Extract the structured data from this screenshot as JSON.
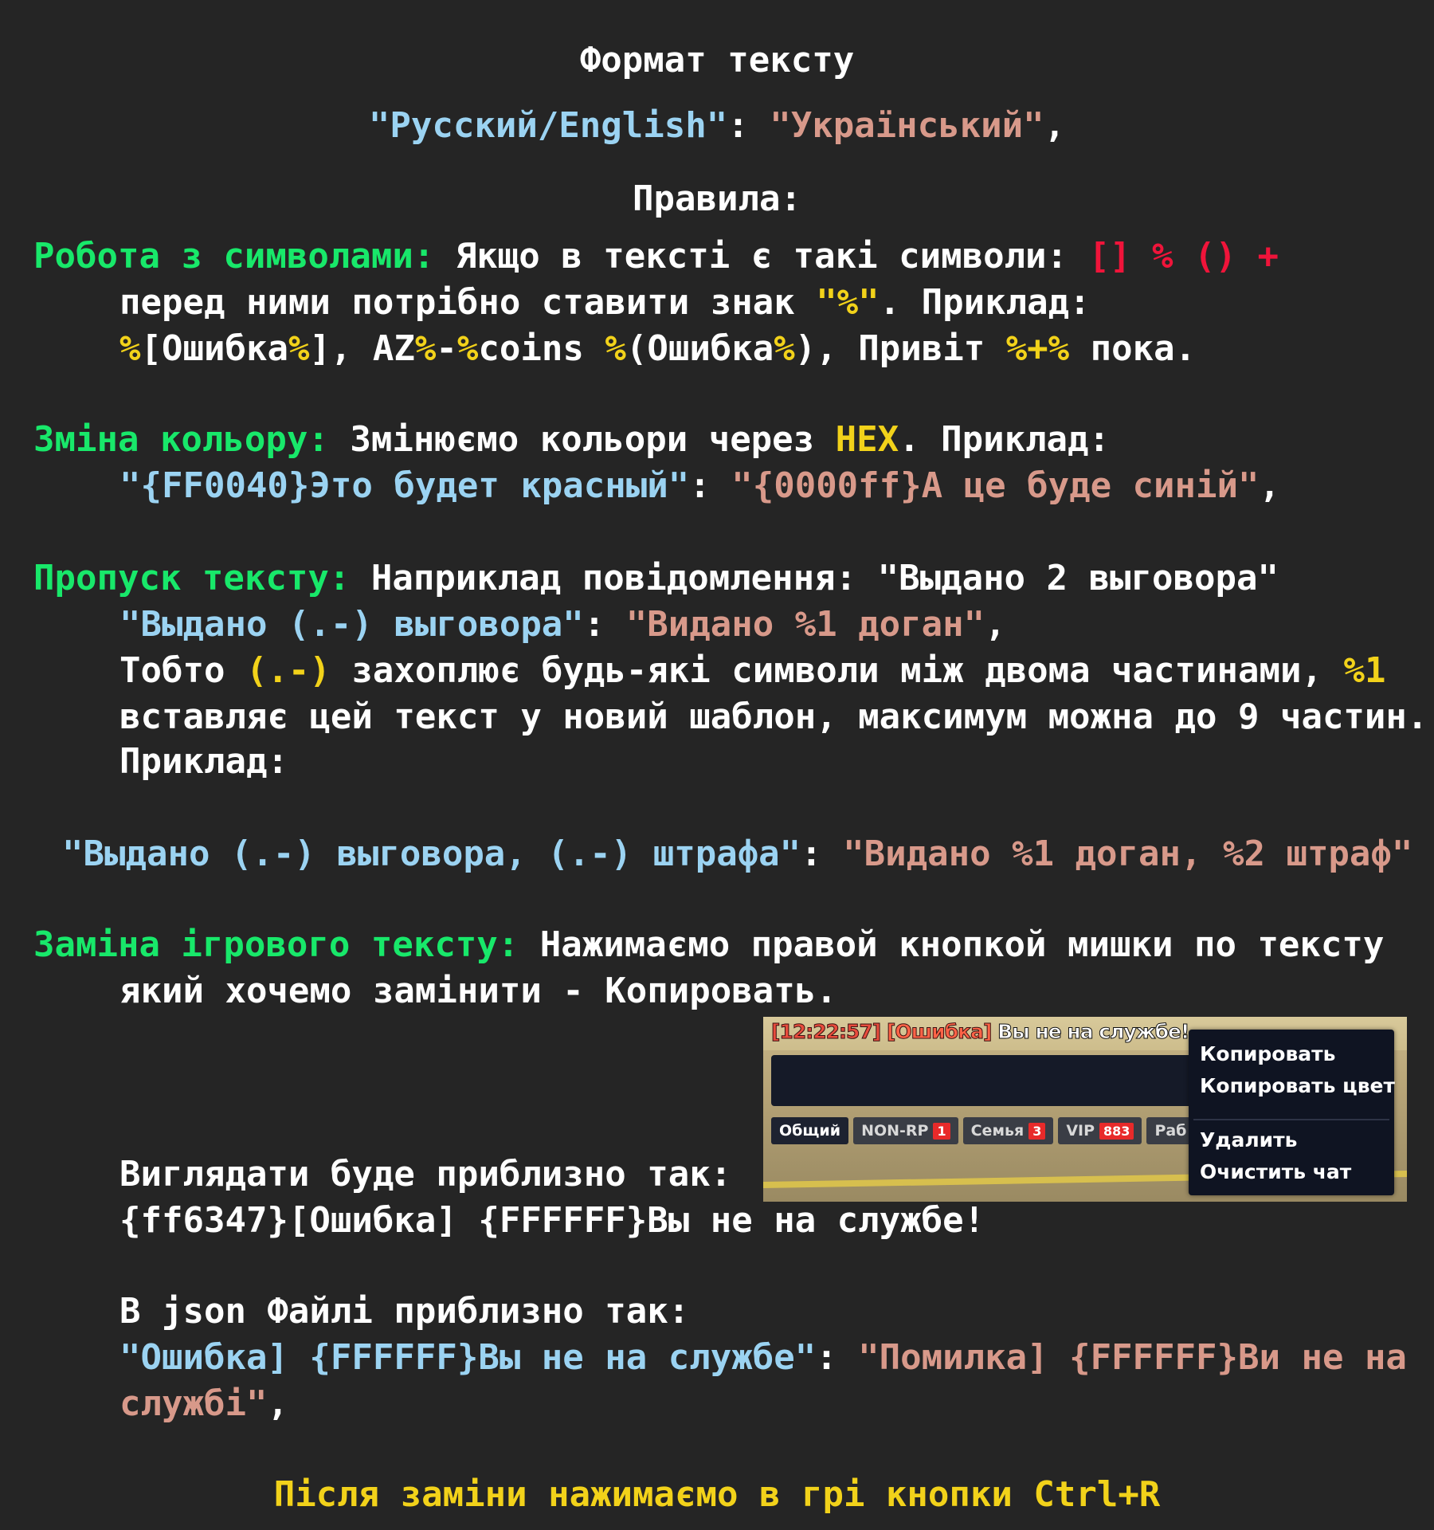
{
  "title": "Формат тексту",
  "format_line": {
    "key": "\"Русский/English\"",
    "sep": ": ",
    "value": "\"Український\"",
    "end": ","
  },
  "rules_heading": "Правила:",
  "symbols": {
    "label": "Робота з символами:",
    "text": " Якщо в тексті є такі символи: ",
    "chars": "[] % () +",
    "line2a": "перед ними потрібно ставити знак ",
    "line2b": "\"%\"",
    "line2c": ". Приклад:",
    "ex": [
      "%",
      "[Ошибка",
      "%",
      "], AZ",
      "%",
      "-",
      "%",
      "coins ",
      "%",
      "(Ошибка",
      "%",
      "), Привіт ",
      "%+%",
      " пока."
    ]
  },
  "color": {
    "label": "Зміна кольору:",
    "text1": " Змінюємо кольори через ",
    "hex": "HEX",
    "text2": ". Приклад:",
    "ex_key": "\"{FF0040}Это будет красный\"",
    "ex_sep": ": ",
    "ex_value": "\"{0000ff}А це буде синій\"",
    "ex_end": ","
  },
  "skip": {
    "label": "Пропуск тексту:",
    "text": " Наприклад повідомлення: \"Выдано 2 выговора\"",
    "ex_key": "\"Выдано (.-) выговора\"",
    "ex_sep": ": ",
    "ex_value": "\"Видано %1 доган\"",
    "ex_end": ",",
    "l3a": "Тобто ",
    "l3b": "(.-)",
    "l3c": " захоплює будь-які символи між двома частинами, ",
    "l3d": "%1",
    "l4": "вставляє цей текст у новий шаблон, максимум можна до 9 частин.",
    "l5": "Приклад:",
    "ex2_key": "\"Выдано (.-) выговора, (.-) штрафа\"",
    "ex2_sep": ": ",
    "ex2_value": "\"Видано %1 доган, %2 штраф\""
  },
  "replace": {
    "label": "Заміна ігрового тексту:",
    "text": " Нажимаємо правой кнопкой мишки по тексту",
    "l2": "який хочемо замінити - Копировать.",
    "looks": "Виглядати буде приблизно так:",
    "looks_value": "{ff6347}[Ошибка] {FFFFFF}Вы не на службе!",
    "json": "В json Файлі приблизно так:",
    "json_key": "\"Ошибка] {FFFFFF}Вы не на службе\"",
    "json_sep": ": ",
    "json_value_1": "\"Помилка] {FFFFFF}Ви не на",
    "json_value_2": "службі\"",
    "json_end": ","
  },
  "footer": "Після заміни нажимаємо в грі кнопки Ctrl+R",
  "screenshot": {
    "time": "[12:22:57]",
    "error": "[Ошибка]",
    "message": "Вы не на службе!",
    "tabs": [
      {
        "label": "Общий",
        "badge": ""
      },
      {
        "label": "NON-RP",
        "badge": "1"
      },
      {
        "label": "Семья",
        "badge": "3"
      },
      {
        "label": "VIP",
        "badge": "883"
      },
      {
        "label": "Раб",
        "badge": ""
      }
    ],
    "menu": [
      "Копировать",
      "Копировать цвет",
      "Удалить",
      "Очистить чат"
    ]
  }
}
